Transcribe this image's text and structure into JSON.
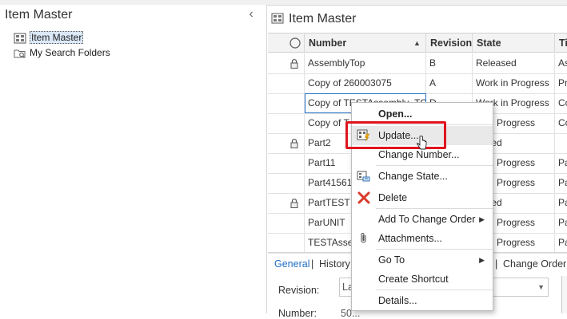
{
  "left_panel": {
    "title": "Item Master",
    "collapse_glyph": "‹",
    "tree": [
      {
        "label": "Item Master",
        "icon": "item-master-icon",
        "selected": true
      },
      {
        "label": "My Search Folders",
        "icon": "search-folder-icon",
        "selected": false
      }
    ]
  },
  "right_panel": {
    "title": "Item Master",
    "grid": {
      "columns": [
        "Number",
        "Revision",
        "State",
        "Ti"
      ],
      "sort_glyph": "▲",
      "rows": [
        {
          "locked": true,
          "number": "AssemblyTop",
          "revision": "B",
          "state": "Released",
          "title": "As"
        },
        {
          "locked": false,
          "number": "Copy of 260003075",
          "revision": "A",
          "state": "Work in Progress",
          "title": "Pr"
        },
        {
          "locked": false,
          "number": "Copy of TESTAssembly_TC",
          "revision": "D",
          "state": "Work in Progress",
          "title": "Co"
        },
        {
          "locked": false,
          "number": "Copy of T",
          "revision": "",
          "state": "rk in Progress",
          "title": "Co"
        },
        {
          "locked": true,
          "number": "Part2",
          "revision": "",
          "state": "eased",
          "title": ""
        },
        {
          "locked": false,
          "number": "Part11",
          "revision": "",
          "state": "rk in Progress",
          "title": "Pa"
        },
        {
          "locked": false,
          "number": "Part415615",
          "revision": "",
          "state": "rk in Progress",
          "title": "Pa"
        },
        {
          "locked": true,
          "number": "PartTEST",
          "revision": "",
          "state": "eased",
          "title": "Pa"
        },
        {
          "locked": false,
          "number": "ParUNIT",
          "revision": "",
          "state": "rk in Progress",
          "title": "Pa"
        },
        {
          "locked": false,
          "number": "TESTAssem",
          "revision": "",
          "state": "rk in Progress",
          "title": "Pa"
        }
      ]
    },
    "tabs": {
      "general": "General",
      "sep1": "|",
      "history": "History",
      "sep2": "|",
      "change_order": "Change Order"
    },
    "details": {
      "revision_label": "Revision:",
      "revision_value": "La",
      "number_label": "Number:",
      "number_value": "50..."
    }
  },
  "context_menu": {
    "items": [
      {
        "key": "open",
        "label": "Open...",
        "bold": true
      },
      {
        "key": "update",
        "label": "Update...",
        "icon": "update-icon"
      },
      {
        "key": "change_number",
        "label": "Change Number..."
      },
      {
        "key": "change_state",
        "label": "Change State...",
        "icon": "change-state-icon"
      },
      {
        "key": "delete",
        "label": "Delete",
        "icon": "delete-icon"
      },
      {
        "key": "add_to_co",
        "label": "Add To Change Order",
        "submenu": true
      },
      {
        "key": "attachments",
        "label": "Attachments...",
        "icon": "paperclip-icon"
      },
      {
        "key": "go_to",
        "label": "Go To",
        "submenu": true
      },
      {
        "key": "create_shortcut",
        "label": "Create Shortcut"
      },
      {
        "key": "details",
        "label": "Details..."
      }
    ],
    "submenu_glyph": "▶"
  },
  "colors": {
    "highlight": "#e0141e",
    "selection_outline": "#2a73c9",
    "delete_red": "#d83a2a"
  }
}
